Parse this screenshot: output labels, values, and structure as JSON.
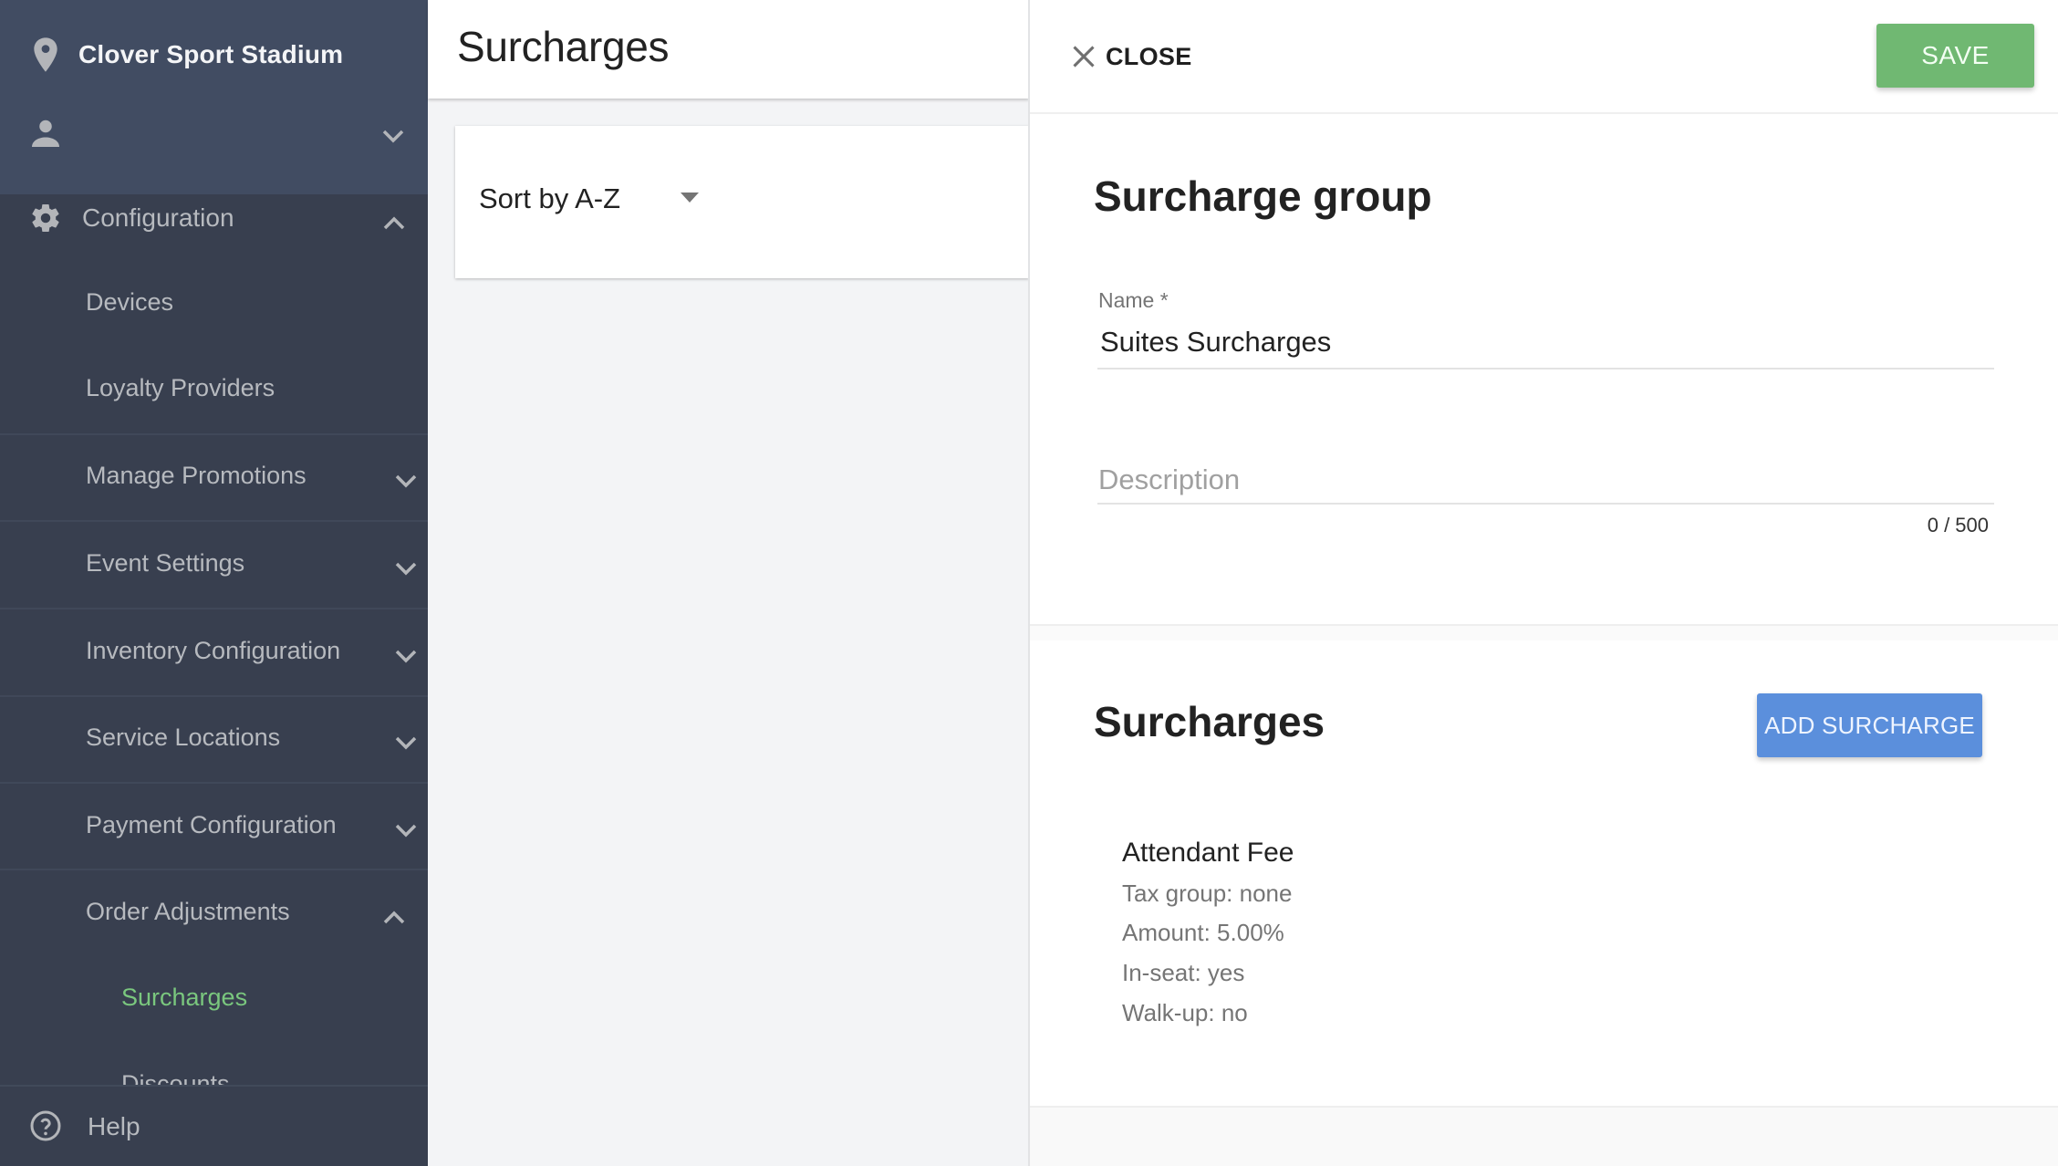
{
  "sidebar": {
    "venue_name": "Clover Sport Stadium",
    "venue_icon": "location-pin-icon",
    "user_icon": "person-icon",
    "config": {
      "label": "Configuration",
      "icon": "gear-icon",
      "expanded": true
    },
    "items": [
      {
        "label": "Devices",
        "expandable": false
      },
      {
        "label": "Loyalty Providers",
        "expandable": false
      },
      {
        "label": "Manage Promotions",
        "expandable": true,
        "expanded": false
      },
      {
        "label": "Event Settings",
        "expandable": true,
        "expanded": false
      },
      {
        "label": "Inventory Configuration",
        "expandable": true,
        "expanded": false
      },
      {
        "label": "Service Locations",
        "expandable": true,
        "expanded": false
      },
      {
        "label": "Payment Configuration",
        "expandable": true,
        "expanded": false
      },
      {
        "label": "Order Adjustments",
        "expandable": true,
        "expanded": true
      }
    ],
    "sub_items": [
      {
        "label": "Surcharges",
        "active": true
      },
      {
        "label": "Discounts",
        "active": false
      }
    ],
    "help_label": "Help",
    "colors": {
      "active": "#7ac77e",
      "background": "#383f4f",
      "header_background": "#414c62"
    }
  },
  "middle": {
    "title": "Surcharges",
    "sort": {
      "selected": "Sort by A-Z"
    }
  },
  "panel": {
    "close_label": "CLOSE",
    "save_label": "SAVE",
    "group_title": "Surcharge group",
    "name_field": {
      "label": "Name *",
      "value": "Suites Surcharges"
    },
    "description_field": {
      "placeholder": "Description",
      "value": "",
      "counter": "0 / 500"
    },
    "surcharges_title": "Surcharges",
    "add_label": "ADD SURCHARGE",
    "surcharges": [
      {
        "name": "Attendant Fee",
        "details": [
          "Tax group: none",
          "Amount: 5.00%",
          "In-seat: yes",
          "Walk-up: no"
        ]
      }
    ],
    "colors": {
      "save": "#70b872",
      "add": "#5b8fdc"
    }
  }
}
